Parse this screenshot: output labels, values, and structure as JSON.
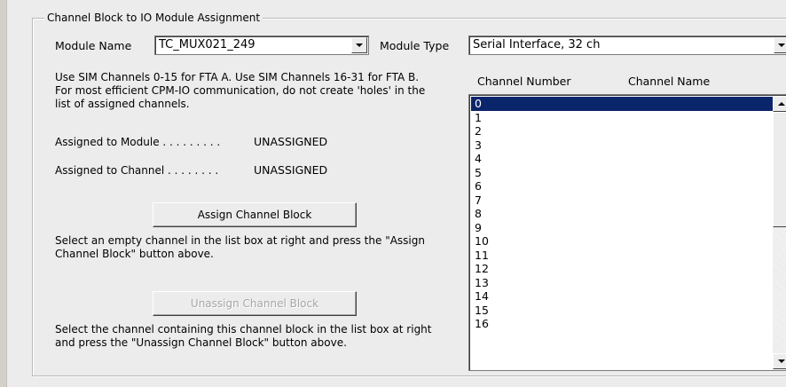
{
  "group": {
    "title": "Channel Block to IO Module Assignment"
  },
  "module_name": {
    "label": "Module Name",
    "value": "TC_MUX021_249"
  },
  "module_type": {
    "label": "Module Type",
    "value": "Serial Interface, 32 ch"
  },
  "info": "Use SIM Channels 0-15 for FTA A.  Use SIM Channels 16-31 for FTA B.  For most efficient CPM-IO communication, do not create 'holes' in the list of assigned channels.",
  "assigned_module": {
    "label": "Assigned to Module . . . . . . . . .",
    "value": "UNASSIGNED"
  },
  "assigned_channel": {
    "label": "Assigned to Channel . . . . . . . .",
    "value": "UNASSIGNED"
  },
  "assign": {
    "label": "Assign Channel Block",
    "help": "Select an empty channel in the list box at right and press the \"Assign Channel Block\" button above."
  },
  "unassign": {
    "label": "Unassign Channel Block",
    "help": "Select the channel containing this channel block in the list box at right and press the \"Unassign Channel Block\" button above."
  },
  "list": {
    "col_number": "Channel Number",
    "col_name": "Channel Name",
    "items": [
      "0",
      "1",
      "2",
      "3",
      "4",
      "5",
      "6",
      "7",
      "8",
      "9",
      "10",
      "11",
      "12",
      "13",
      "14",
      "15",
      "16"
    ],
    "selected_index": 0
  },
  "colors": {
    "selection": "#0b256b",
    "disabled_text": "#a6a6a6"
  },
  "icons": {
    "dropdown": "chevron-down-icon",
    "scroll_up": "scroll-up-arrow-icon",
    "scroll_down": "scroll-down-arrow-icon"
  }
}
